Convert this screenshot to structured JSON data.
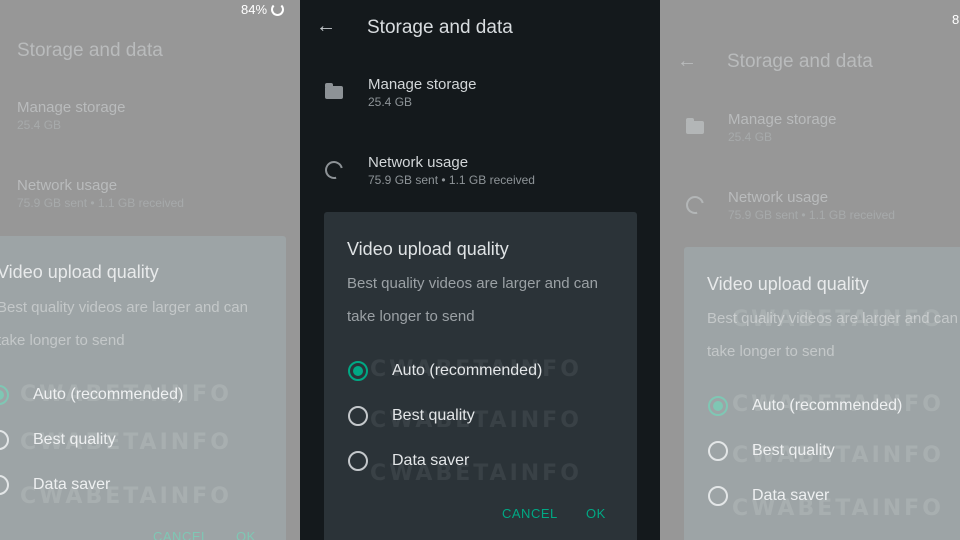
{
  "status": {
    "battery": "84%",
    "battery_right_clipped": "8"
  },
  "app_bar": {
    "title": "Storage and data"
  },
  "settings": {
    "manage_storage": {
      "title": "Manage storage",
      "subtitle": "25.4 GB"
    },
    "network_usage": {
      "title": "Network usage",
      "subtitle": "75.9 GB sent • 1.1 GB received"
    }
  },
  "dialog": {
    "title": "Video upload quality",
    "description": "Best quality videos are larger and can take longer to send",
    "options": [
      {
        "label": "Auto (recommended)",
        "selected": true
      },
      {
        "label": "Best quality",
        "selected": false
      },
      {
        "label": "Data saver",
        "selected": false
      }
    ],
    "cancel_label": "CANCEL",
    "ok_label": "OK"
  },
  "watermark": "CWABETAINFO",
  "colors": {
    "accent": "#00a884",
    "dialog_bg": "#2b3338",
    "screen_bg": "#14191c"
  }
}
